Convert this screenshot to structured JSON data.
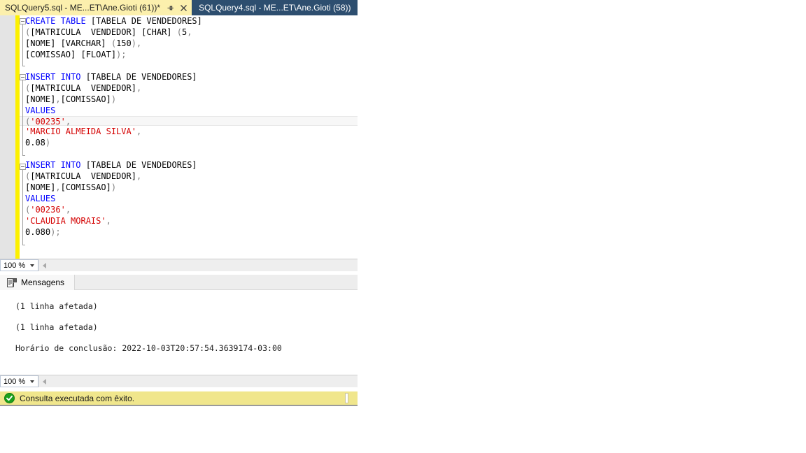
{
  "tabs": [
    {
      "label": "SQLQuery5.sql - ME...ET\\Ane.Gioti (61))*",
      "active": true,
      "pin_icon": "pin-icon",
      "close_icon": "close-icon"
    },
    {
      "label": "SQLQuery4.sql - ME...ET\\Ane.Gioti (58))",
      "active": false
    }
  ],
  "editor": {
    "lines": [
      {
        "collapse": true,
        "segments": [
          {
            "t": "CREATE TABLE ",
            "c": "kw"
          },
          {
            "t": "[TABELA DE VENDEDORES]",
            "c": "id"
          }
        ]
      },
      {
        "collapse": false,
        "segments": [
          {
            "t": "(",
            "c": "punc"
          },
          {
            "t": "[MATRICULA  VENDEDOR] [CHAR] ",
            "c": "id"
          },
          {
            "t": "(",
            "c": "punc"
          },
          {
            "t": "5",
            "c": "num"
          },
          {
            "t": ",",
            "c": "punc"
          }
        ]
      },
      {
        "collapse": false,
        "segments": [
          {
            "t": "[NOME] [VARCHAR] ",
            "c": "id"
          },
          {
            "t": "(",
            "c": "punc"
          },
          {
            "t": "150",
            "c": "num"
          },
          {
            "t": "),",
            "c": "punc"
          }
        ]
      },
      {
        "collapse": false,
        "segments": [
          {
            "t": "[COMISSAO] [FLOAT]",
            "c": "id"
          },
          {
            "t": ");",
            "c": "punc"
          }
        ]
      },
      {
        "collapse": false,
        "segments": []
      },
      {
        "collapse": true,
        "segments": [
          {
            "t": "INSERT INTO ",
            "c": "kw"
          },
          {
            "t": "[TABELA DE VENDEDORES]",
            "c": "id"
          }
        ]
      },
      {
        "collapse": false,
        "segments": [
          {
            "t": "(",
            "c": "punc"
          },
          {
            "t": "[MATRICULA  VENDEDOR]",
            "c": "id"
          },
          {
            "t": ",",
            "c": "punc"
          }
        ]
      },
      {
        "collapse": false,
        "segments": [
          {
            "t": "[NOME]",
            "c": "id"
          },
          {
            "t": ",",
            "c": "punc"
          },
          {
            "t": "[COMISSAO]",
            "c": "id"
          },
          {
            "t": ")",
            "c": "punc"
          }
        ]
      },
      {
        "collapse": false,
        "segments": [
          {
            "t": "VALUES",
            "c": "kw"
          }
        ]
      },
      {
        "collapse": false,
        "current": true,
        "segments": [
          {
            "t": "(",
            "c": "punc"
          },
          {
            "t": "'00235'",
            "c": "str"
          },
          {
            "t": ",",
            "c": "punc"
          }
        ]
      },
      {
        "collapse": false,
        "segments": [
          {
            "t": "'MARCIO ALMEIDA SILVA'",
            "c": "str"
          },
          {
            "t": ",",
            "c": "punc"
          }
        ]
      },
      {
        "collapse": false,
        "segments": [
          {
            "t": "0.08",
            "c": "num"
          },
          {
            "t": ")",
            "c": "punc"
          }
        ]
      },
      {
        "collapse": false,
        "segments": []
      },
      {
        "collapse": true,
        "segments": [
          {
            "t": "INSERT INTO ",
            "c": "kw"
          },
          {
            "t": "[TABELA DE VENDEDORES]",
            "c": "id"
          }
        ]
      },
      {
        "collapse": false,
        "segments": [
          {
            "t": "(",
            "c": "punc"
          },
          {
            "t": "[MATRICULA  VENDEDOR]",
            "c": "id"
          },
          {
            "t": ",",
            "c": "punc"
          }
        ]
      },
      {
        "collapse": false,
        "segments": [
          {
            "t": "[NOME]",
            "c": "id"
          },
          {
            "t": ",",
            "c": "punc"
          },
          {
            "t": "[COMISSAO]",
            "c": "id"
          },
          {
            "t": ")",
            "c": "punc"
          }
        ]
      },
      {
        "collapse": false,
        "segments": [
          {
            "t": "VALUES",
            "c": "kw"
          }
        ]
      },
      {
        "collapse": false,
        "segments": [
          {
            "t": "(",
            "c": "punc"
          },
          {
            "t": "'00236'",
            "c": "str"
          },
          {
            "t": ",",
            "c": "punc"
          }
        ]
      },
      {
        "collapse": false,
        "segments": [
          {
            "t": "'CLAUDIA MORAIS'",
            "c": "str"
          },
          {
            "t": ",",
            "c": "punc"
          }
        ]
      },
      {
        "collapse": false,
        "segments": [
          {
            "t": "0.080",
            "c": "num"
          },
          {
            "t": ");",
            "c": "punc"
          }
        ]
      }
    ],
    "zoom": {
      "value": "100 %",
      "caret_icon": "chevron-down-icon",
      "scroll_left_icon": "arrow-left-icon"
    }
  },
  "results": {
    "tab": {
      "label": "Mensagens",
      "icon": "messages-icon"
    },
    "messages": [
      "(1 linha afetada)",
      "",
      "(1 linha afetada)",
      "",
      "Horário de conclusão: 2022-10-03T20:57:54.3639174-03:00"
    ],
    "zoom": {
      "value": "100 %",
      "caret_icon": "chevron-down-icon",
      "scroll_left_icon": "arrow-left-icon"
    }
  },
  "statusbar": {
    "icon": "success-check-icon",
    "text": "Consulta executada com êxito.",
    "colors": {
      "background": "#f0e68c",
      "success": "#1ba01b"
    }
  },
  "colors": {
    "keyword": "#0000ff",
    "string": "#d40000",
    "punctuation": "#808080",
    "active_tab": "#fcf0ad",
    "inactive_tab": "#2d4e6f",
    "change_bar": "#fcf000"
  }
}
